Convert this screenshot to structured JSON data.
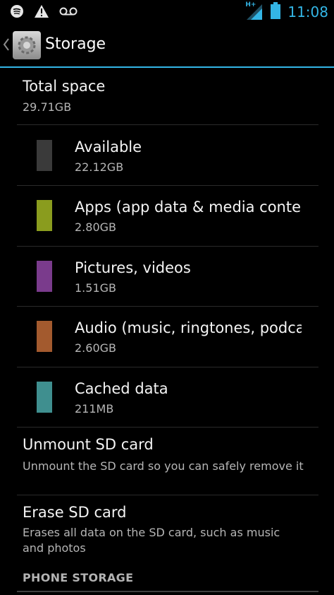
{
  "status_bar": {
    "time": "11:08",
    "network_label": "H+",
    "icons": [
      "spotify-icon",
      "warning-icon",
      "voicemail-icon",
      "signal-icon",
      "battery-icon"
    ]
  },
  "action_bar": {
    "title": "Storage",
    "accent": "#33b5e5"
  },
  "total": {
    "label": "Total space",
    "value": "29.71GB"
  },
  "categories": [
    {
      "label": "Available",
      "value": "22.12GB",
      "color": "#3a3a3a"
    },
    {
      "label": "Apps (app data & media content)",
      "value": "2.80GB",
      "color": "#8a9c1e"
    },
    {
      "label": "Pictures, videos",
      "value": "1.51GB",
      "color": "#7a3b8c"
    },
    {
      "label": "Audio (music, ringtones, podcasts)",
      "value": "2.60GB",
      "color": "#a35a2e"
    },
    {
      "label": "Cached data",
      "value": "211MB",
      "color": "#3f8f8f"
    }
  ],
  "unmount": {
    "title": "Unmount SD card",
    "summary": "Unmount the SD card so you can safely remove it"
  },
  "erase": {
    "title": "Erase SD card",
    "summary": "Erases all data on the SD card, such as music and photos"
  },
  "section_header": "PHONE STORAGE"
}
